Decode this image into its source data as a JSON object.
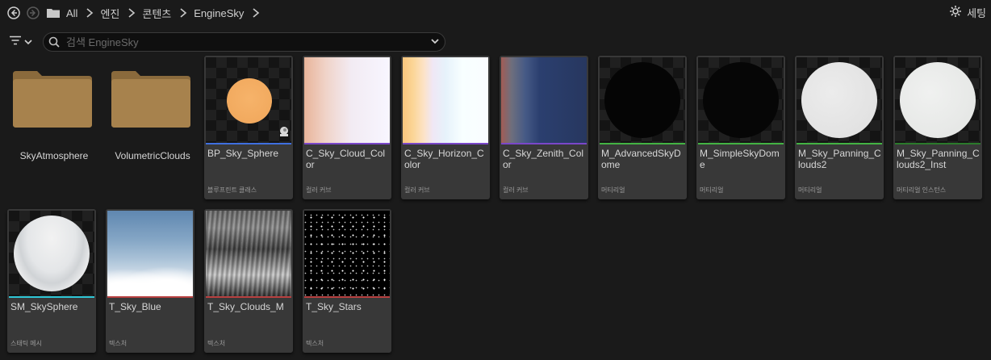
{
  "breadcrumb": {
    "items": [
      "All",
      "엔진",
      "콘텐츠",
      "EngineSky"
    ]
  },
  "settings_label": "세팅",
  "search": {
    "placeholder": "검색 EngineSky"
  },
  "icons": {
    "back": "back-arrow-icon",
    "forward": "forward-arrow-icon",
    "folder": "folder-icon",
    "chevron": "chevron-right-icon",
    "gear": "gear-icon",
    "filter": "filter-icon",
    "search": "search-icon",
    "dropdown": "chevron-down-icon"
  },
  "folders": [
    {
      "name": "SkyAtmosphere"
    },
    {
      "name": "VolumetricClouds"
    }
  ],
  "assets": [
    {
      "name": "BP_Sky_Sphere",
      "type": "블루프린트 클래스",
      "color": "#3f6fe0"
    },
    {
      "name": "C_Sky_Cloud_Color",
      "type": "컬러 커브",
      "color": "#7a47c9"
    },
    {
      "name": "C_Sky_Horizon_Color",
      "type": "컬러 커브",
      "color": "#7a47c9"
    },
    {
      "name": "C_Sky_Zenith_Color",
      "type": "컬러 커브",
      "color": "#7a47c9"
    },
    {
      "name": "M_AdvancedSkyDome",
      "type": "머티리얼",
      "color": "#43b343"
    },
    {
      "name": "M_SimpleSkyDome",
      "type": "머티리얼",
      "color": "#43b343"
    },
    {
      "name": "M_Sky_Panning_Clouds2",
      "type": "머티리얼",
      "color": "#43b343"
    },
    {
      "name": "M_Sky_Panning_Clouds2_Inst",
      "type": "머티리얼 인스턴스",
      "color": "#2b7a2b"
    },
    {
      "name": "SM_SkySphere",
      "type": "스태틱 메시",
      "color": "#2fc7d6"
    },
    {
      "name": "T_Sky_Blue",
      "type": "텍스처",
      "color": "#b84040"
    },
    {
      "name": "T_Sky_Clouds_M",
      "type": "텍스처",
      "color": "#b84040"
    },
    {
      "name": "T_Sky_Stars",
      "type": "텍스처",
      "color": "#b84040"
    }
  ]
}
